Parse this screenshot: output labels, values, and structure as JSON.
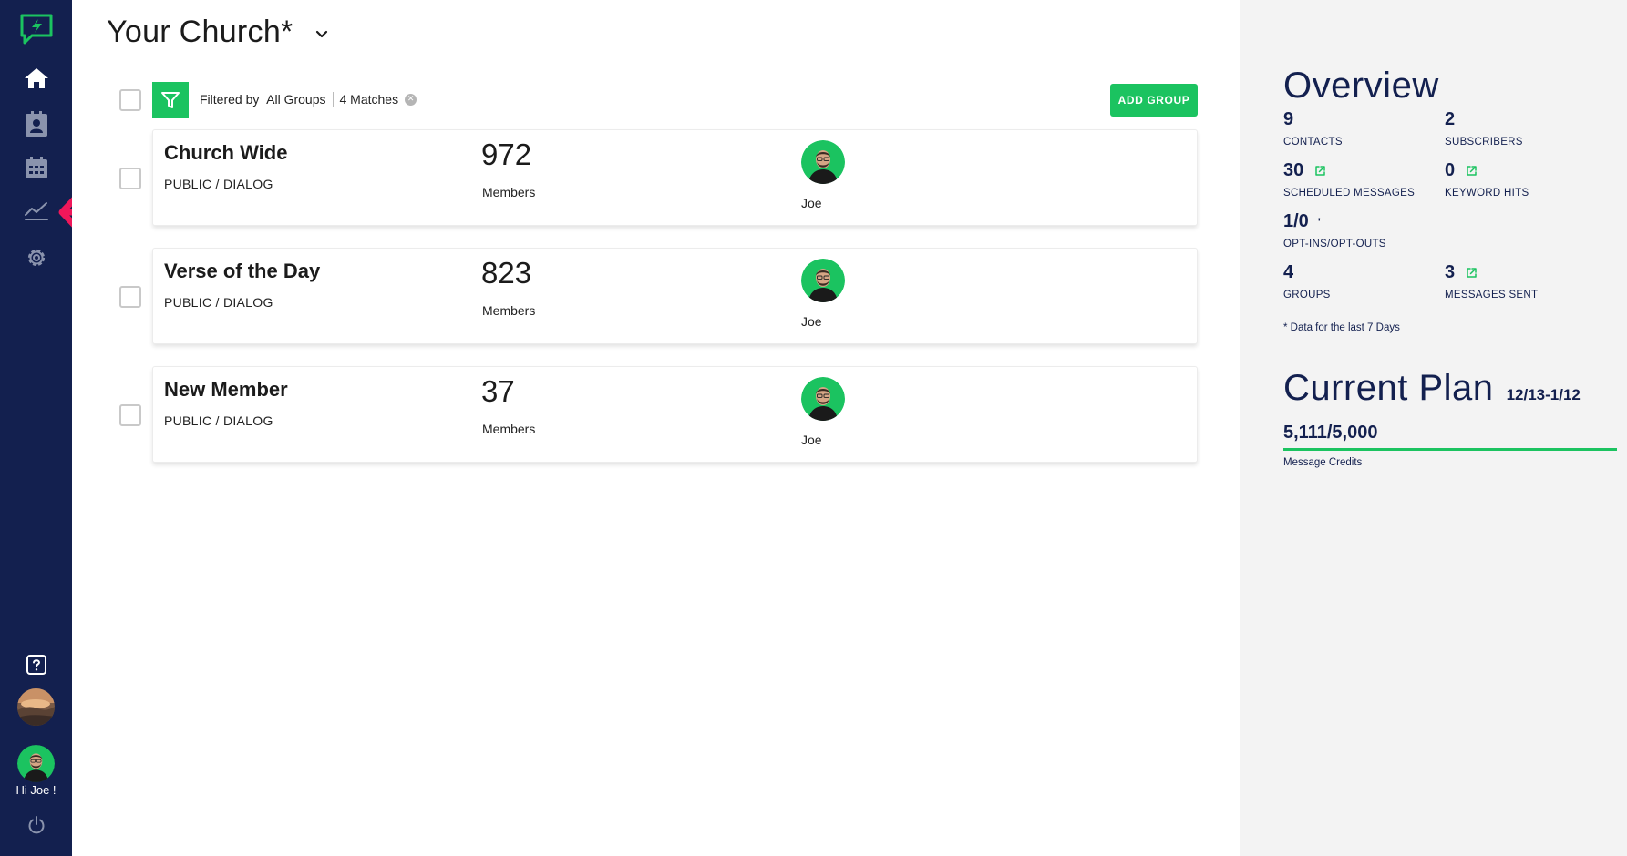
{
  "sidebar": {
    "greeting": "Hi Joe !",
    "icons": [
      "chat-logo-icon",
      "home-icon",
      "contacts-icon",
      "calendar-icon",
      "analytics-icon",
      "settings-icon",
      "help-icon",
      "power-icon"
    ]
  },
  "header": {
    "title": "Your Church*"
  },
  "filter_bar": {
    "filtered_by_label": "Filtered by",
    "filter_value": "All Groups",
    "matches": "4 Matches",
    "add_group_label": "ADD GROUP"
  },
  "groups": [
    {
      "name": "Church Wide",
      "type": "PUBLIC / DIALOG",
      "count": "972",
      "count_label": "Members",
      "owner": "Joe"
    },
    {
      "name": "Verse of the Day",
      "type": "PUBLIC / DIALOG",
      "count": "823",
      "count_label": "Members",
      "owner": "Joe"
    },
    {
      "name": "New Member",
      "type": "PUBLIC / DIALOG",
      "count": "37",
      "count_label": "Members",
      "owner": "Joe"
    }
  ],
  "overview": {
    "title": "Overview",
    "stats": {
      "contacts": {
        "value": "9",
        "label": "CONTACTS"
      },
      "subscribers": {
        "value": "2",
        "label": "SUBSCRIBERS"
      },
      "scheduled": {
        "value": "30",
        "label": "SCHEDULED MESSAGES"
      },
      "keyword": {
        "value": "0",
        "label": "KEYWORD HITS"
      },
      "optins": {
        "value": "1/0",
        "label": "OPT-INS/OPT-OUTS",
        "tick": "'"
      },
      "groups": {
        "value": "4",
        "label": "GROUPS"
      },
      "sent": {
        "value": "3",
        "label": "MESSAGES SENT"
      }
    },
    "note": "* Data for the last 7 Days"
  },
  "plan": {
    "title": "Current Plan",
    "dates": "12/13-1/12",
    "credits": "5,111/5,000",
    "credits_label": "Message Credits",
    "credits_fraction": 1.0
  },
  "colors": {
    "sidebar": "#13204f",
    "accent": "#1bc360",
    "panel": "#f3f3f3",
    "annotation": "#f0175a"
  }
}
